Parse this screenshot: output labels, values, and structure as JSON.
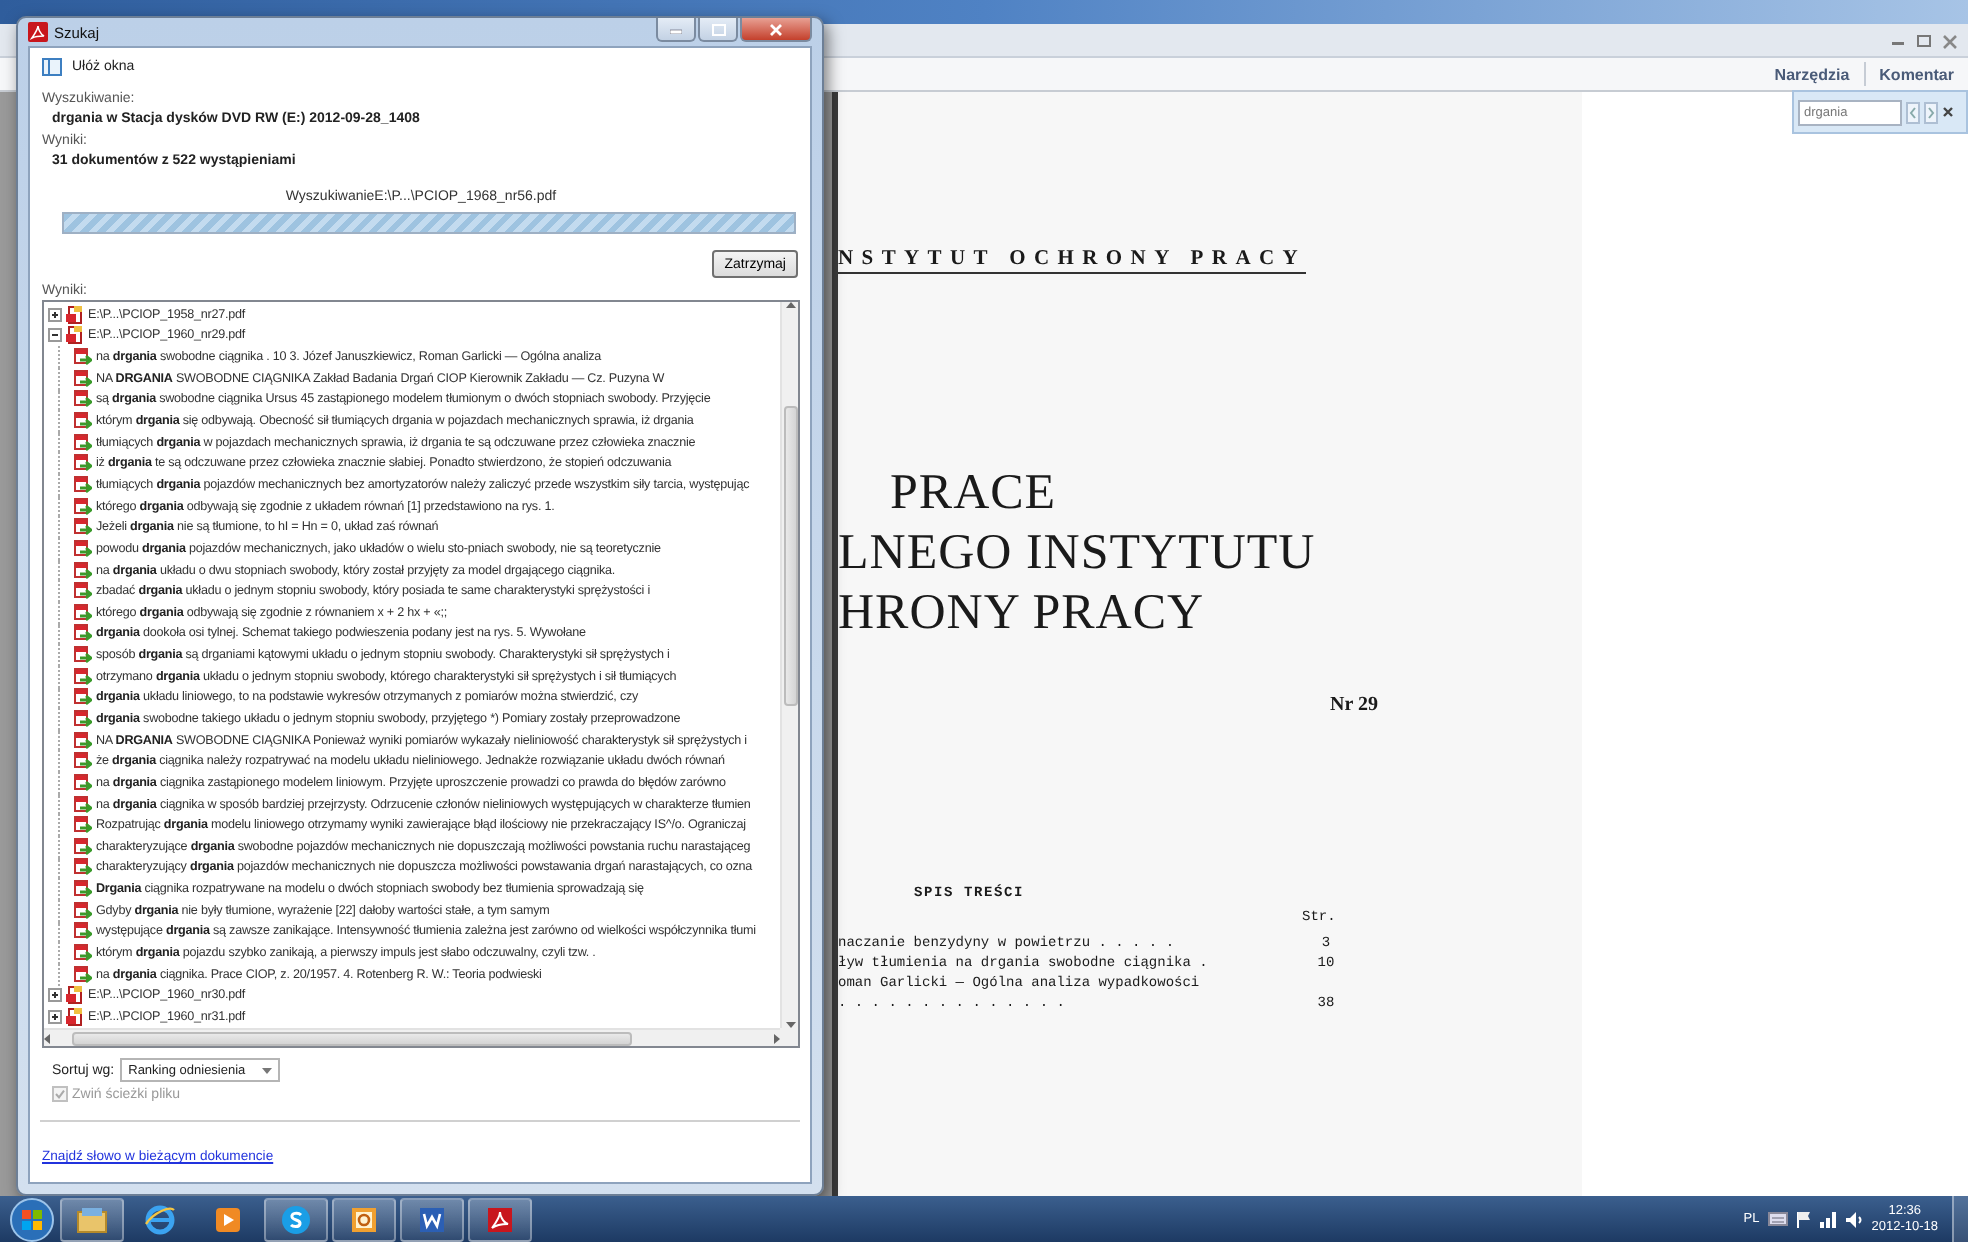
{
  "reader": {
    "toolbar_buttons": [
      "Narzędzia",
      "Komentar"
    ],
    "find_box": {
      "value": "drgania"
    },
    "document": {
      "header": "NSTYTUT OCHRONY PRACY",
      "title_lines": [
        "PRACE",
        "LNEGO INSTYTUTU",
        "HRONY PRACY"
      ],
      "number": "Nr 29",
      "contents_title": "SPIS TREŚCI",
      "page_heading": "Str.",
      "contents": [
        {
          "title": "naczanie benzydyny w powietrzu . . . . .",
          "page": "3"
        },
        {
          "title": "ływ tłumienia na drgania swobodne ciągnika .",
          "page": "10"
        },
        {
          "title": "oman Garlicki — Ogólna analiza wypadkowości"
        },
        {
          "title": ". . . . . . . . . . . . . .",
          "page": "38"
        }
      ]
    }
  },
  "dialog": {
    "title": "Szukaj",
    "arrange_label": "Ułóż okna",
    "search_label": "Wyszukiwanie:",
    "search_query": "drgania w Stacja dysków DVD RW (E:) 2012-09-28_1408",
    "results_label": "Wyniki:",
    "results_summary": "31 dokumentów z 522 wystąpieniami",
    "progress_text": "WyszukiwanieE:\\P...\\PCIOP_1968_nr56.pdf",
    "progress": {
      "level": 1
    },
    "stop_button": "Zatrzymaj",
    "list_label": "Wyniki:",
    "results": [
      {
        "file": "E:\\P...\\PCIOP_1958_nr27.pdf",
        "expanded": false
      },
      {
        "file": "E:\\P...\\PCIOP_1960_nr29.pdf",
        "expanded": true,
        "children": [
          {
            "text": "na **drgania** swobodne ciągnika . 10 3. Józef Januszkiewicz, Roman Garlicki — Ogólna analiza"
          },
          {
            "text": "NA **DRGANIA** SWOBODNE CIĄGNIKA Zakład Badania Drgań CIOP Kierownik Zakładu — Cz. Puzyna W"
          },
          {
            "text": "są **drgania** swobodne ciągnika Ursus 45 zastąpionego modelem tłumionym o dwóch stopniach swobody. Przyjęcie"
          },
          {
            "text": "którym **drgania** się odbywają. Obecność sił tłumiących drgania w pojazdach mechanicznych sprawia, iż drgania"
          },
          {
            "text": "tłumiących **drgania** w pojazdach mechanicznych sprawia, iż drgania te są odczuwane przez człowieka znacznie"
          },
          {
            "text": "iż **drgania** te są odczuwane przez człowieka znacznie słabiej. Ponadto stwierdzono, że stopień odczuwania"
          },
          {
            "text": "tłumiących **drgania** pojazdów mechanicznych bez amortyzatorów należy zaliczyć przede wszystkim siły tarcia, występując"
          },
          {
            "text": "którego **drgania** odbywają się zgodnie z układem równań [1] przedstawiono na rys. 1."
          },
          {
            "text": "Jeżeli **drgania** nie są tłumione, to hI = Hn = 0, układ zaś równań"
          },
          {
            "text": "powodu **drgania** pojazdów mechanicznych, jako układów o wielu sto-pniach swobody, nie są teoretycznie"
          },
          {
            "text": "na **drgania** układu o dwu stopniach swobody, który został przyjęty za model drgającego ciągnika."
          },
          {
            "text": "zbadać **drgania** układu o jednym stopniu swobody, który posiada te same charakterystyki sprężystości i"
          },
          {
            "text": "którego **drgania** odbywają się zgodnie z równaniem x + 2 hx + «;;"
          },
          {
            "text": "**drgania** dookoła osi tylnej. Schemat takiego podwieszenia podany jest na rys. 5. Wywołane"
          },
          {
            "text": "sposób **drgania** są drganiami kątowymi układu o jednym stopniu swobody. Charakterystyki sił sprężystych i"
          },
          {
            "text": "otrzymano **drgania** układu o jednym stopniu swobody, którego charakterystyki sił sprężystych i sił tłumiących"
          },
          {
            "text": "**drgania** układu liniowego, to na podstawie wykresów otrzymanych z pomiarów można stwierdzić, czy"
          },
          {
            "text": "**drgania** swobodne takiego układu o jednym stopniu swobody, przyjętego *) Pomiary zostały przeprowadzone"
          },
          {
            "text": "NA **DRGANIA** SWOBODNE CIĄGNIKA Ponieważ wyniki pomiarów wykazały nieliniowość charakterystyk sił sprężystych i"
          },
          {
            "text": "że **drgania** ciągnika należy rozpatrywać na modelu układu nieliniowego. Jednakże rozwiązanie układu dwóch równań"
          },
          {
            "text": "na **drgania** ciągnika zastąpionego modelem liniowym. Przyjęte uproszczenie prowadzi co prawda do błędów zarówno"
          },
          {
            "text": "na **drgania** ciągnika w sposób bardziej przejrzysty. Odrzucenie członów nieliniowych występujących w charakterze tłumien"
          },
          {
            "text": "Rozpatrując **drgania** modelu liniowego otrzymamy wyniki zawierające błąd ilościowy nie przekraczający IS^/o. Ograniczaj"
          },
          {
            "text": "charakteryzujące **drgania** swobodne pojazdów mechanicznych nie dopuszczają możliwości powstania ruchu narastająceg"
          },
          {
            "text": "charakteryzujący **drgania** pojazdów mechanicznych nie dopuszcza możliwości powstawania drgań narastających, co ozna"
          },
          {
            "text": "**Drgania** ciągnika rozpatrywane na modelu o dwóch stopniach swobody bez tłumienia sprowadzają się"
          },
          {
            "text": "Gdyby **drgania** nie były tłumione, wyrażenie [22] dałoby wartości stałe, a tym samym"
          },
          {
            "text": "występujące **drgania** są zawsze zanikające. Intensywność tłumienia zależna jest zarówno od wielkości współczynnika tłumi"
          },
          {
            "text": "którym **drgania** pojazdu szybko zanikają, a pierwszy impuls jest słabo odczuwalny, czyli tzw. ."
          },
          {
            "text": "na **drgania** ciągnika. Prace CIOP, z. 20/1957. 4. Rotenberg R. W.: Teoria podwieski"
          }
        ]
      },
      {
        "file": "E:\\P...\\PCIOP_1960_nr30.pdf",
        "expanded": false
      },
      {
        "file": "E:\\P...\\PCIOP_1960_nr31.pdf",
        "expanded": false
      }
    ],
    "sort_label": "Sortuj wg:",
    "sort_value": "Ranking odniesienia",
    "collapse_paths": {
      "label": "Zwiń ścieżki pliku",
      "checked": true,
      "disabled": true
    },
    "link": "Znajdź słowo w bieżącym dokumencie"
  },
  "taskbar": {
    "apps": [
      {
        "kind": "folder",
        "running": true
      },
      {
        "kind": "browser",
        "running": false
      },
      {
        "kind": "media",
        "running": false
      },
      {
        "kind": "skype",
        "running": true
      },
      {
        "kind": "outlook",
        "running": true
      },
      {
        "kind": "word",
        "running": true
      },
      {
        "kind": "acrobat",
        "running": true
      }
    ],
    "language": "PL",
    "time": "12:36",
    "date": "2012-10-18"
  }
}
